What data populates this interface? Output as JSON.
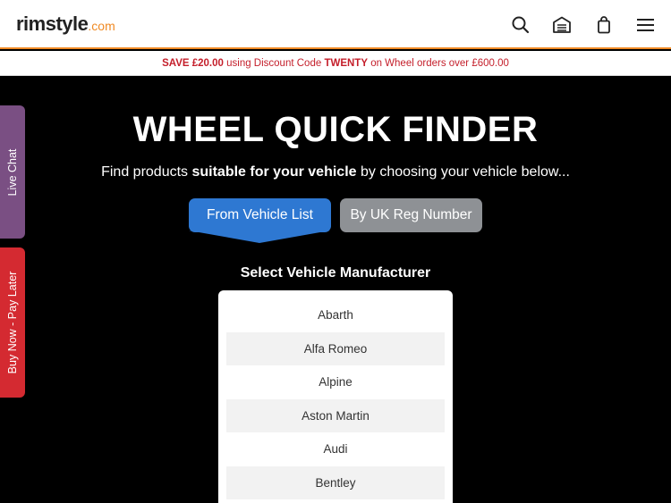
{
  "header": {
    "logo_main": "rimstyle",
    "logo_tld": ".com",
    "icons": [
      "search-icon",
      "garage-icon",
      "bag-icon",
      "menu-icon"
    ]
  },
  "promo": {
    "save": "SAVE £20.00",
    "middle": " using Discount Code ",
    "code": "TWENTY",
    "end": " on Wheel orders over £600.00"
  },
  "hero": {
    "title": "WHEEL QUICK FINDER",
    "subtitle_start": "Find products ",
    "subtitle_bold": "suitable for your vehicle",
    "subtitle_end": " by choosing your vehicle below..."
  },
  "tabs": {
    "vehicle_list": "From Vehicle List",
    "reg_number": "By UK Reg Number"
  },
  "manufacturer": {
    "label": "Select Vehicle Manufacturer",
    "items": [
      "Abarth",
      "Alfa Romeo",
      "Alpine",
      "Aston Martin",
      "Audi",
      "Bentley"
    ]
  },
  "side": {
    "chat": "Live Chat",
    "pay_later": "Buy Now - Pay Later"
  },
  "colors": {
    "accent": "#f08a24",
    "primary_tab": "#2e78d2",
    "secondary_tab": "#8e9195",
    "promo_text": "#c41e2a",
    "chat_tab": "#7a4f83",
    "pay_later_tab": "#d42a31"
  }
}
